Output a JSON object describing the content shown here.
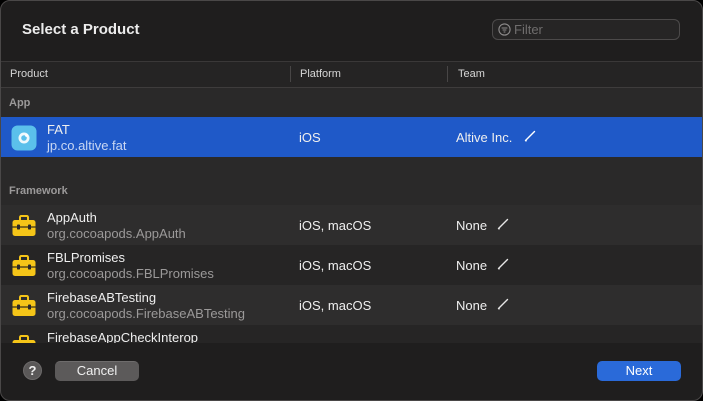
{
  "dialog": {
    "title": "Select a Product",
    "filter_placeholder": "Filter"
  },
  "table": {
    "columns": [
      "Product",
      "Platform",
      "Team"
    ],
    "groups": [
      {
        "label": "App",
        "rows": [
          {
            "name": "FAT",
            "bundle": "jp.co.altive.fat",
            "platform": "iOS",
            "team": "Altive Inc.",
            "icon": "app-icon",
            "selected": true
          }
        ]
      },
      {
        "label": "Framework",
        "rows": [
          {
            "name": "AppAuth",
            "bundle": "org.cocoapods.AppAuth",
            "platform": "iOS, macOS",
            "team": "None",
            "icon": "toolbox-icon"
          },
          {
            "name": "FBLPromises",
            "bundle": "org.cocoapods.FBLPromises",
            "platform": "iOS, macOS",
            "team": "None",
            "icon": "toolbox-icon"
          },
          {
            "name": "FirebaseABTesting",
            "bundle": "org.cocoapods.FirebaseABTesting",
            "platform": "iOS, macOS",
            "team": "None",
            "icon": "toolbox-icon"
          },
          {
            "name": "FirebaseAppCheckInterop",
            "bundle": "",
            "platform": "",
            "team": "",
            "icon": "toolbox-icon"
          }
        ]
      }
    ]
  },
  "footer": {
    "help_label": "?",
    "cancel_label": "Cancel",
    "next_label": "Next"
  },
  "colors": {
    "selection": "#1f59c8",
    "primary_button": "#2a6ad9",
    "toolbox_yellow": "#f5c518"
  }
}
